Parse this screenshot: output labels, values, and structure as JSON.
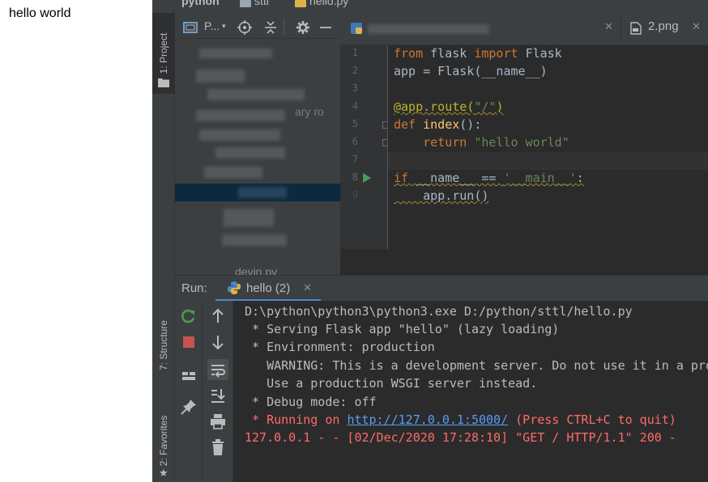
{
  "browser": {
    "body_text": "hello world"
  },
  "ide": {
    "breadcrumbs": [
      {
        "label": "python"
      },
      {
        "label": "sttl"
      },
      {
        "label": "hello.py"
      }
    ],
    "tool_stripe": {
      "project_tab": "1: Project",
      "structure_tab": "7: Structure",
      "favorites_tab": "2: Favorites"
    },
    "project_panel": {
      "view_label": "P...",
      "faint_texts": [
        "ary ro",
        "devin.py"
      ]
    },
    "editor_tabs": [
      {
        "label": "2.png"
      }
    ],
    "code": {
      "line_numbers": [
        "1",
        "2",
        "3",
        "4",
        "5",
        "6",
        "7",
        "8",
        "9"
      ],
      "lines": [
        {
          "segments": [
            {
              "t": "from ",
              "c": "kw"
            },
            {
              "t": "flask ",
              "c": ""
            },
            {
              "t": "import ",
              "c": "kw"
            },
            {
              "t": "Flask",
              "c": ""
            }
          ]
        },
        {
          "segments": [
            {
              "t": "app = Flask(__name__)",
              "c": ""
            }
          ]
        },
        {
          "segments": []
        },
        {
          "segments": [
            {
              "t": "@app.route(",
              "c": "deco"
            },
            {
              "t": "\"/\"",
              "c": "str"
            },
            {
              "t": ")",
              "c": "deco"
            }
          ]
        },
        {
          "segments": [
            {
              "t": "def ",
              "c": "kw"
            },
            {
              "t": "index",
              "c": "fn"
            },
            {
              "t": "():",
              "c": ""
            }
          ]
        },
        {
          "segments": [
            {
              "t": "    return ",
              "c": "kw"
            },
            {
              "t": "\"hello world\"",
              "c": "str"
            }
          ]
        },
        {
          "segments": []
        },
        {
          "segments": [
            {
              "t": "if ",
              "c": "kw"
            },
            {
              "t": "__name__ == ",
              "c": ""
            },
            {
              "t": "'__main__'",
              "c": "str"
            },
            {
              "t": ":",
              "c": ""
            }
          ]
        },
        {
          "segments": [
            {
              "t": "    app.run()",
              "c": ""
            }
          ]
        }
      ]
    },
    "run_panel": {
      "label": "Run:",
      "tab_label": "hello (2)"
    },
    "console": {
      "lines": [
        {
          "text": "D:\\python\\python3\\python3.exe D:/python/sttl/hello.py",
          "kind": "normal"
        },
        {
          "text": " * Serving Flask app \"hello\" (lazy loading)",
          "kind": "normal"
        },
        {
          "text": " * Environment: production",
          "kind": "normal"
        },
        {
          "text": "   WARNING: This is a development server. Do not use it in a production deployment.",
          "kind": "normal"
        },
        {
          "text": "   Use a production WSGI server instead.",
          "kind": "normal"
        },
        {
          "text": " * Debug mode: off",
          "kind": "normal"
        }
      ],
      "running_prefix": " * Running on ",
      "running_link": "http://127.0.0.1:5000/",
      "running_suffix": " (Press CTRL+C to quit)",
      "request_line": "127.0.0.1 - - [02/Dec/2020 17:28:10] \"GET / HTTP/1.1\" 200 -"
    },
    "colors": {
      "editor_bg": "#2b2b2b",
      "panel_bg": "#3c3f41",
      "keyword": "#cc7832",
      "string": "#6a8759",
      "function": "#ffc66d",
      "decorator": "#bbb529",
      "console_red": "#ff6b68",
      "link": "#589df6",
      "run_green": "#499c54",
      "stop_red": "#c75450",
      "tab_underline": "#4a88c7"
    },
    "icons": {
      "rerun": "rerun-icon",
      "stop": "stop-icon",
      "up": "arrow-up-icon",
      "down": "arrow-down-icon",
      "soft_wrap": "soft-wrap-icon",
      "scroll_end": "scroll-to-end-icon",
      "print": "print-icon",
      "trash": "trash-icon",
      "layout": "layout-icon",
      "pin": "pin-icon",
      "target": "locate-icon",
      "collapse": "collapse-icon",
      "gear": "gear-icon",
      "hide": "hide-icon"
    }
  }
}
